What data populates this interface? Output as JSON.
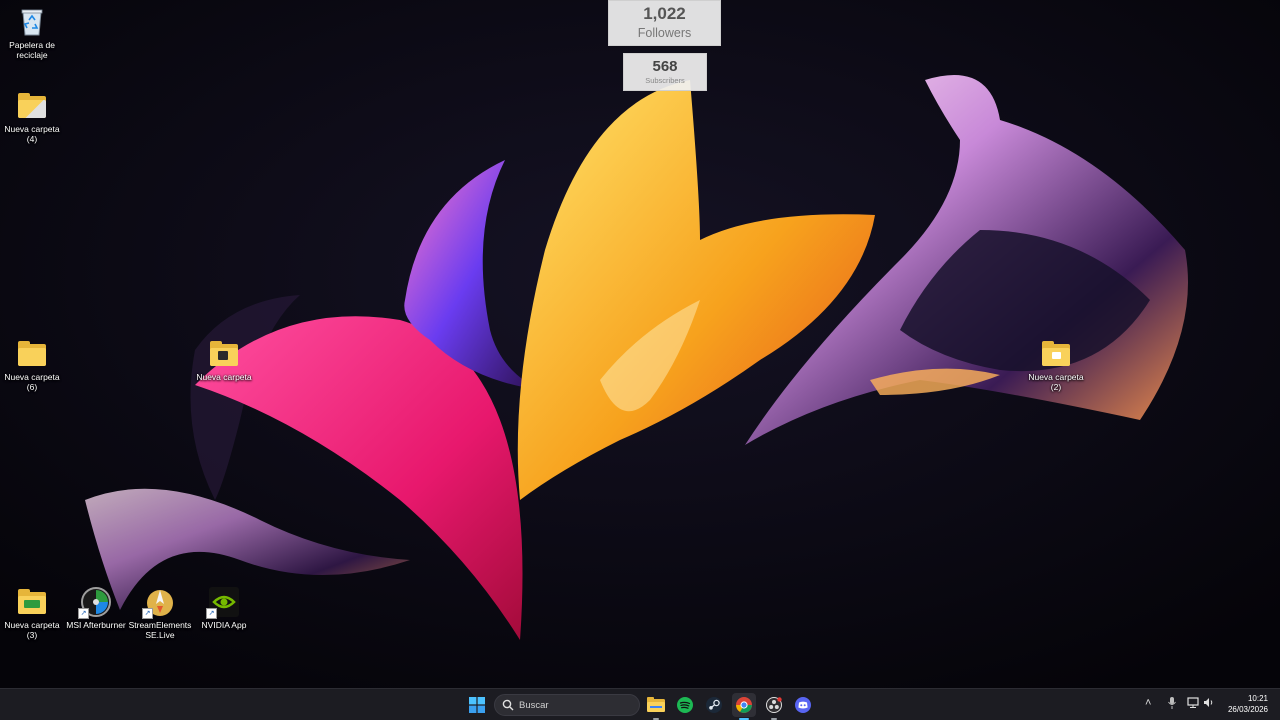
{
  "widgets": {
    "followers": {
      "count": "1,022",
      "caption": "Followers"
    },
    "subscribers": {
      "count": "568",
      "caption": "Subscribers"
    }
  },
  "desktop": {
    "icons": {
      "recycle_bin": "Papelera de reciclaje",
      "folder_4": "Nueva carpeta (4)",
      "folder_6": "Nueva carpeta (6)",
      "folder_plain": "Nueva carpeta",
      "folder_2": "Nueva carpeta (2)",
      "folder_3": "Nueva carpeta (3)",
      "msi_afterburner": "MSI Afterburner",
      "streamelements": "StreamElements SE.Live",
      "nvidia_app": "NVIDIA App"
    }
  },
  "taskbar": {
    "search_placeholder": "Buscar",
    "pinned": [
      "start-icon",
      "file-explorer-icon",
      "spotify-icon",
      "steam-icon",
      "chrome-icon",
      "obs-icon",
      "discord-icon"
    ],
    "clock": {
      "time": "10:21",
      "date": "26/03/2026"
    }
  },
  "colors": {
    "folder": "#f9d15a",
    "taskbar": "#1c1c22",
    "accent_blue": "#3b82f6",
    "discord": "#5865f2",
    "spotify": "#1db954"
  }
}
